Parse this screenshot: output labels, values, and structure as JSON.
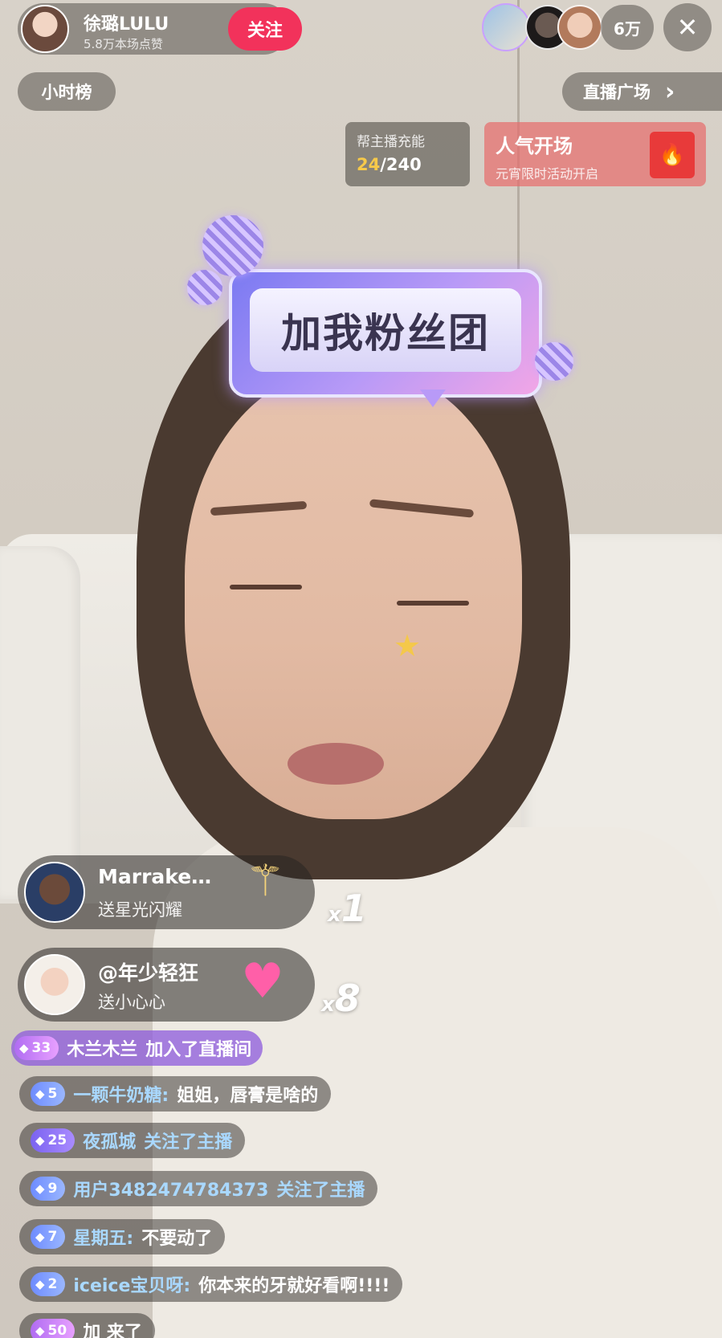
{
  "host": {
    "name": "徐璐LULU",
    "likes": "5.8万本场点赞",
    "follow_label": "关注"
  },
  "header": {
    "viewer_count": "6万",
    "close_label": "✕",
    "rank_label": "小时榜",
    "plaza_label": "直播广场",
    "plaza_chevron": "›"
  },
  "charge": {
    "title": "帮主播充能",
    "current": "24",
    "total": "/240"
  },
  "popular": {
    "title": "人气开场",
    "subtitle": "元宵限时活动开启"
  },
  "sticker": {
    "fanclub_text": "加我粉丝团"
  },
  "gifts": [
    {
      "user": "Marrake…",
      "desc": "送星光闪耀",
      "x": "x",
      "count": "1",
      "icon": "wand-icon"
    },
    {
      "user": "@年少轻狂",
      "desc": "送小心心",
      "x": "x",
      "count": "8",
      "icon": "heart-icon"
    }
  ],
  "join": {
    "level": "33",
    "name": "木兰木兰",
    "text": "加入了直播间"
  },
  "chat": [
    {
      "level": "5",
      "tier": "low",
      "name": "一颗牛奶糖",
      "sep": ":",
      "text": "姐姐，唇膏是啥的"
    },
    {
      "level": "25",
      "tier": "mid",
      "name": "夜孤城",
      "sep": "",
      "text": "关注了主播"
    },
    {
      "level": "9",
      "tier": "low",
      "name": "用户3482474784373",
      "sep": "",
      "text": "关注了主播"
    },
    {
      "level": "7",
      "tier": "low",
      "name": "星期五",
      "sep": ":",
      "text": "不要动了"
    },
    {
      "level": "2",
      "tier": "low",
      "name": "iceice宝贝呀",
      "sep": ":",
      "text": "你本来的牙就好看啊!!!!"
    },
    {
      "level": "50",
      "tier": "high",
      "name": "",
      "sep": "",
      "text": "加 来了"
    }
  ],
  "colors": {
    "follow": "#f2325b",
    "join_bg": "#8c5adc",
    "chat_name": "#a9d8ff",
    "charge_current": "#f6c94a"
  }
}
